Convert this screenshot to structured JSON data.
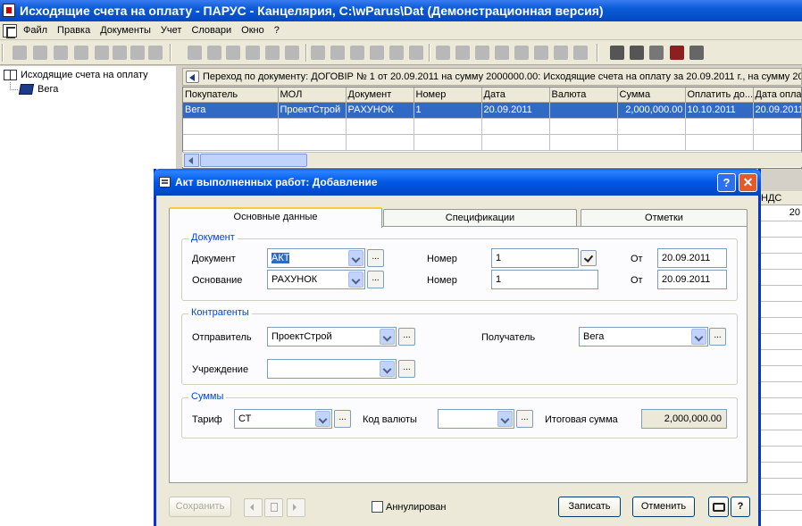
{
  "window": {
    "title": "Исходящие счета на оплату - ПАРУС - Канцелярия, C:\\wParus\\Dat (Демонстрационная версия)"
  },
  "menu": [
    "Файл",
    "Правка",
    "Документы",
    "Учет",
    "Словари",
    "Окно",
    "?"
  ],
  "tree": {
    "root": "Исходящие счета на оплату",
    "child": "Вега"
  },
  "navigation": {
    "text": "Переход по документу: ДОГОВІР № 1 от 20.09.2011 на сумму 2000000.00: Исходящие счета на оплату за 20.09.2011 г., на сумму 20"
  },
  "grid": {
    "columns": [
      "Покупатель",
      "МОЛ",
      "Документ",
      "Номер",
      "Дата",
      "Валюта",
      "Сумма",
      "Оплатить до...",
      "Дата оплат"
    ],
    "rows": [
      [
        "Вега",
        "ПроектСтрой",
        "РАХУНОК",
        "1",
        "20.09.2011",
        "",
        "2,000,000.00",
        "10.10.2011",
        "20.09.2011"
      ]
    ]
  },
  "spec_grid": {
    "header": "НДС",
    "first_value": "20"
  },
  "dialog": {
    "title": "Акт выполненных работ: Добавление",
    "help": "?",
    "tabs": [
      "Основные данные",
      "Спецификации",
      "Отметки"
    ],
    "document_group": {
      "legend": "Документ",
      "doc_label": "Документ",
      "doc_value": "АКТ",
      "basis_label": "Основание",
      "basis_value": "РАХУНОК",
      "number_label": "Номер",
      "number_value": "1",
      "number2_label": "Номер",
      "number2_value": "1",
      "from_label": "От",
      "from_value": "20.09.2011",
      "from2_label": "От",
      "from2_value": "20.09.2011"
    },
    "contragents_group": {
      "legend": "Контрагенты",
      "sender_label": "Отправитель",
      "sender_value": "ПроектСтрой",
      "receiver_label": "Получатель",
      "receiver_value": "Вега",
      "institution_label": "Учреждение",
      "institution_value": ""
    },
    "sums_group": {
      "legend": "Суммы",
      "tariff_label": "Тариф",
      "tariff_value": "СТ",
      "currency_label": "Код валюты",
      "currency_value": "",
      "total_label": "Итоговая сумма",
      "total_value": "2,000,000.00"
    },
    "dots": "...",
    "buttons": {
      "save": "Сохранить",
      "annulled": "Аннулирован",
      "record": "Записать",
      "cancel": "Отменить",
      "help2": "?"
    }
  }
}
